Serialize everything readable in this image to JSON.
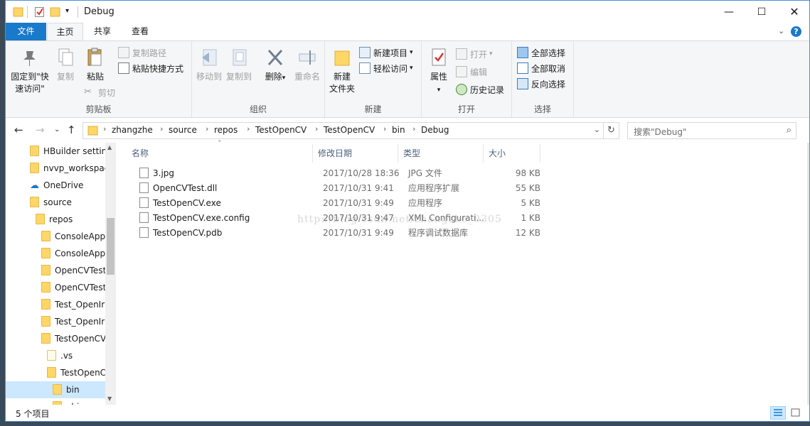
{
  "window": {
    "title": "Debug"
  },
  "ribbon_tabs": {
    "file": "文件",
    "home": "主页",
    "share": "共享",
    "view": "查看"
  },
  "ribbon": {
    "clipboard": {
      "label": "剪贴板",
      "pin_line1": "固定到\"快",
      "pin_line2": "速访问\"",
      "copy": "复制",
      "paste": "粘贴",
      "copy_path": "复制路径",
      "paste_shortcut": "粘贴快捷方式",
      "cut": "剪切"
    },
    "organize": {
      "label": "组织",
      "move_to": "移动到",
      "copy_to": "复制到",
      "delete": "删除",
      "rename": "重命名"
    },
    "new": {
      "label": "新建",
      "new_folder_line1": "新建",
      "new_folder_line2": "文件夹",
      "new_item": "新建项目",
      "easy_access": "轻松访问"
    },
    "open": {
      "label": "打开",
      "properties": "属性",
      "open": "打开",
      "edit": "编辑",
      "history": "历史记录"
    },
    "select": {
      "label": "选择",
      "select_all": "全部选择",
      "select_none": "全部取消",
      "invert": "反向选择"
    }
  },
  "address": {
    "crumbs": [
      "zhangzhe",
      "source",
      "repos",
      "TestOpenCV",
      "TestOpenCV",
      "bin",
      "Debug"
    ],
    "search_placeholder": "搜索\"Debug\""
  },
  "nav_tree": [
    {
      "label": "HBuilder settin",
      "indent": 1,
      "type": "folder"
    },
    {
      "label": "nvvp_workspac",
      "indent": 1,
      "type": "folder"
    },
    {
      "label": "OneDrive",
      "indent": 1,
      "type": "onedrive"
    },
    {
      "label": "source",
      "indent": 1,
      "type": "folder"
    },
    {
      "label": "repos",
      "indent": 2,
      "type": "folder"
    },
    {
      "label": "ConsoleApp",
      "indent": 3,
      "type": "folder"
    },
    {
      "label": "ConsoleApp",
      "indent": 3,
      "type": "folder"
    },
    {
      "label": "OpenCVTest",
      "indent": 3,
      "type": "folder"
    },
    {
      "label": "OpenCVTest",
      "indent": 3,
      "type": "folder"
    },
    {
      "label": "Test_OpenIr",
      "indent": 3,
      "type": "folder"
    },
    {
      "label": "Test_OpenIr",
      "indent": 3,
      "type": "folder"
    },
    {
      "label": "TestOpenCV",
      "indent": 3,
      "type": "folder"
    },
    {
      "label": ".vs",
      "indent": 4,
      "type": "white"
    },
    {
      "label": "TestOpenC",
      "indent": 4,
      "type": "folder"
    },
    {
      "label": "bin",
      "indent": 5,
      "type": "folder",
      "selected": true
    },
    {
      "label": "obj",
      "indent": 5,
      "type": "folder"
    }
  ],
  "columns": {
    "name": "名称",
    "modified": "修改日期",
    "type": "类型",
    "size": "大小"
  },
  "files": [
    {
      "name": "3.jpg",
      "modified": "2017/10/28 18:36",
      "type": "JPG 文件",
      "size": "98 KB",
      "icon": "image-file-icon"
    },
    {
      "name": "OpenCVTest.dll",
      "modified": "2017/10/31 9:41",
      "type": "应用程序扩展",
      "size": "55 KB",
      "icon": "dll-file-icon"
    },
    {
      "name": "TestOpenCV.exe",
      "modified": "2017/10/31 9:49",
      "type": "应用程序",
      "size": "5 KB",
      "icon": "exe-file-icon"
    },
    {
      "name": "TestOpenCV.exe.config",
      "modified": "2017/10/31 9:47",
      "type": "XML Configurati...",
      "size": "1 KB",
      "icon": "config-file-icon"
    },
    {
      "name": "TestOpenCV.pdb",
      "modified": "2017/10/31 9:49",
      "type": "程序调试数据库",
      "size": "12 KB",
      "icon": "pdb-file-icon"
    }
  ],
  "watermark": "http://blog.csdn.net/zhangzhe_0305",
  "status": {
    "item_count": "5 个项目"
  },
  "colors": {
    "accent": "#1979ca",
    "selection": "#cce8ff",
    "folder": "#ffd767"
  }
}
